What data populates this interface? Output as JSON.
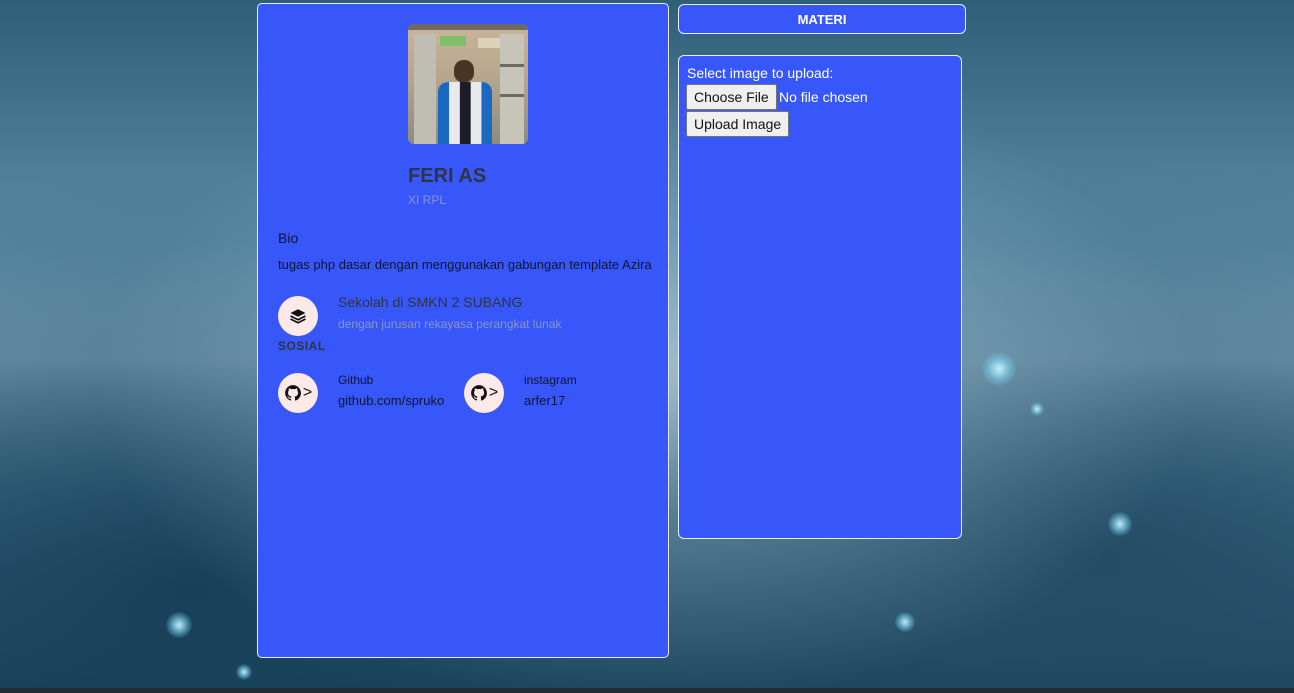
{
  "colors": {
    "card_bg": "#3757fa",
    "card_border": "#e9eefc",
    "icon_circle_bg": "#fce9e8",
    "name_text": "#2f3440",
    "muted_text": "#8a93c7"
  },
  "profile": {
    "name": "FERI AS",
    "subtitle": "XI RPL",
    "bio_label": "Bio",
    "bio_text": "tugas php dasar dengan menggunakan gabungan template Azira",
    "school": {
      "icon": "layers-icon",
      "title": "Sekolah di SMKN 2 SUBANG",
      "subtitle": "dengan jurusan rekayasa perangkat lunak"
    },
    "social_title": "SOSIAL",
    "social": [
      {
        "icon": "github-icon",
        "label": "Github",
        "value": "github.com/spruko"
      },
      {
        "icon": "github-icon",
        "label": "instagram",
        "value": "arfer17"
      }
    ]
  },
  "materi": {
    "button_label": "MATERI"
  },
  "upload": {
    "label": "Select image to upload:",
    "choose_file_label": "Choose File",
    "file_status": "No file chosen",
    "upload_button_label": "Upload Image"
  }
}
